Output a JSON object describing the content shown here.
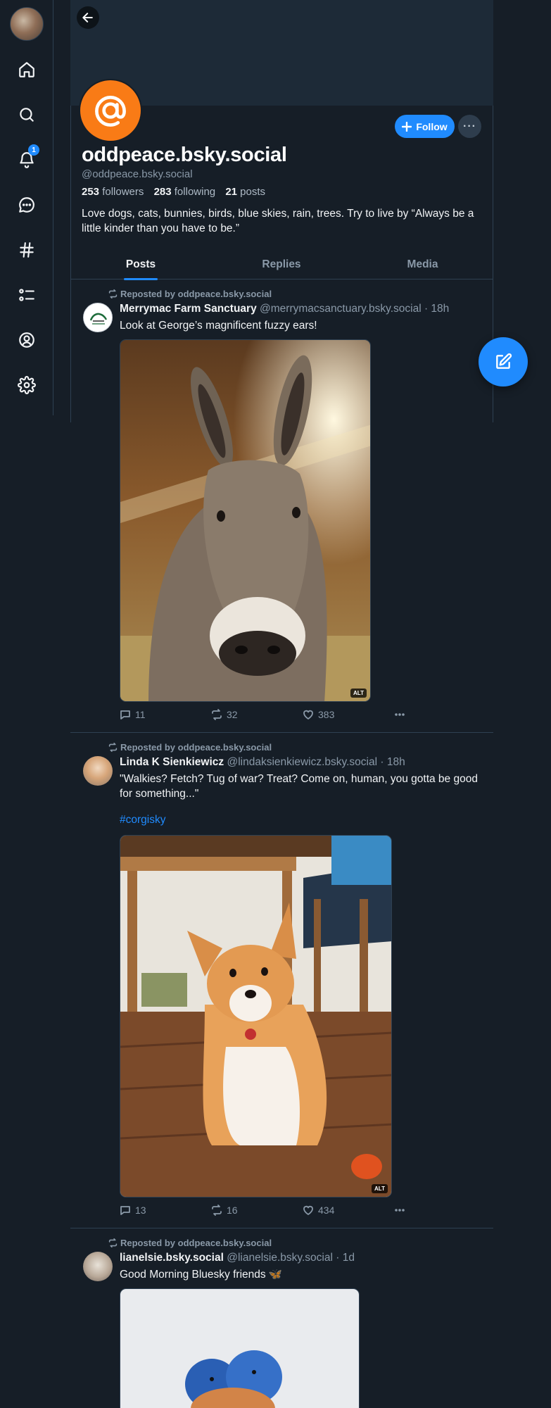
{
  "colors": {
    "background": "#161e27",
    "accent": "#208bfe",
    "avatar_orange": "#f97b16",
    "muted_text": "#8a99a8",
    "border": "#2e4052"
  },
  "nav": {
    "notification_count": "1",
    "icons": [
      "home-icon",
      "search-icon",
      "bell-icon",
      "chat-icon",
      "hashtag-icon",
      "list-icon",
      "profile-icon",
      "gear-icon"
    ]
  },
  "profile": {
    "display_name": "oddpeace.bsky.social",
    "handle": "@oddpeace.bsky.social",
    "followers_count": "253",
    "followers_label": "followers",
    "following_count": "283",
    "following_label": "following",
    "posts_count": "21",
    "posts_label": "posts",
    "bio": "Love dogs, cats, bunnies, birds, blue skies, rain, trees.  Try to live by “Always be a little kinder than you have to be.”",
    "follow_label": "Follow",
    "more_label": "···"
  },
  "tabs": [
    {
      "label": "Posts",
      "active": true
    },
    {
      "label": "Replies",
      "active": false
    },
    {
      "label": "Media",
      "active": false
    }
  ],
  "posts": [
    {
      "repost_label": "Reposted by oddpeace.bsky.social",
      "author_name": "Merrymac Farm Sanctuary",
      "meta": "@merrymacsanctuary.bsky.social · 18h",
      "text": "Look at George’s magnificent fuzzy ears!",
      "alt_label": "ALT",
      "replies": "11",
      "reposts": "32",
      "likes": "383"
    },
    {
      "repost_label": "Reposted by oddpeace.bsky.social",
      "author_name": "Linda K Sienkiewicz",
      "meta": "@lindaksienkiewicz.bsky.social · 18h",
      "text": "\"Walkies? Fetch? Tug of war? Treat? Come on, human, you gotta be good for something...\"",
      "hashtag": "#corgisky",
      "alt_label": "ALT",
      "replies": "13",
      "reposts": "16",
      "likes": "434"
    },
    {
      "repost_label": "Reposted by oddpeace.bsky.social",
      "author_name": "lianelsie.bsky.social",
      "meta": "@lianelsie.bsky.social · 1d",
      "text": "Good Morning Bluesky friends 🦋"
    }
  ]
}
